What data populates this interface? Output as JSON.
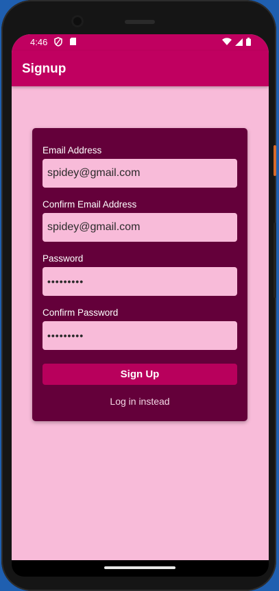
{
  "status_bar": {
    "time": "4:46",
    "left_icons": [
      "shield-icon",
      "sd-card-icon"
    ],
    "right_icons": [
      "wifi-icon",
      "signal-icon",
      "battery-icon"
    ]
  },
  "app_bar": {
    "title": "Signup"
  },
  "form": {
    "email_label": "Email Address",
    "email_value": "spidey@gmail.com",
    "confirm_email_label": "Confirm Email Address",
    "confirm_email_value": "spidey@gmail.com",
    "password_label": "Password",
    "password_value": "•••••••••",
    "confirm_password_label": "Confirm Password",
    "confirm_password_value": "•••••••••",
    "signup_label": "Sign Up",
    "login_link_label": "Log in instead"
  },
  "colors": {
    "primary": "#c00060",
    "card": "#64003a",
    "background": "#f8bbd9",
    "button": "#b8005c"
  }
}
